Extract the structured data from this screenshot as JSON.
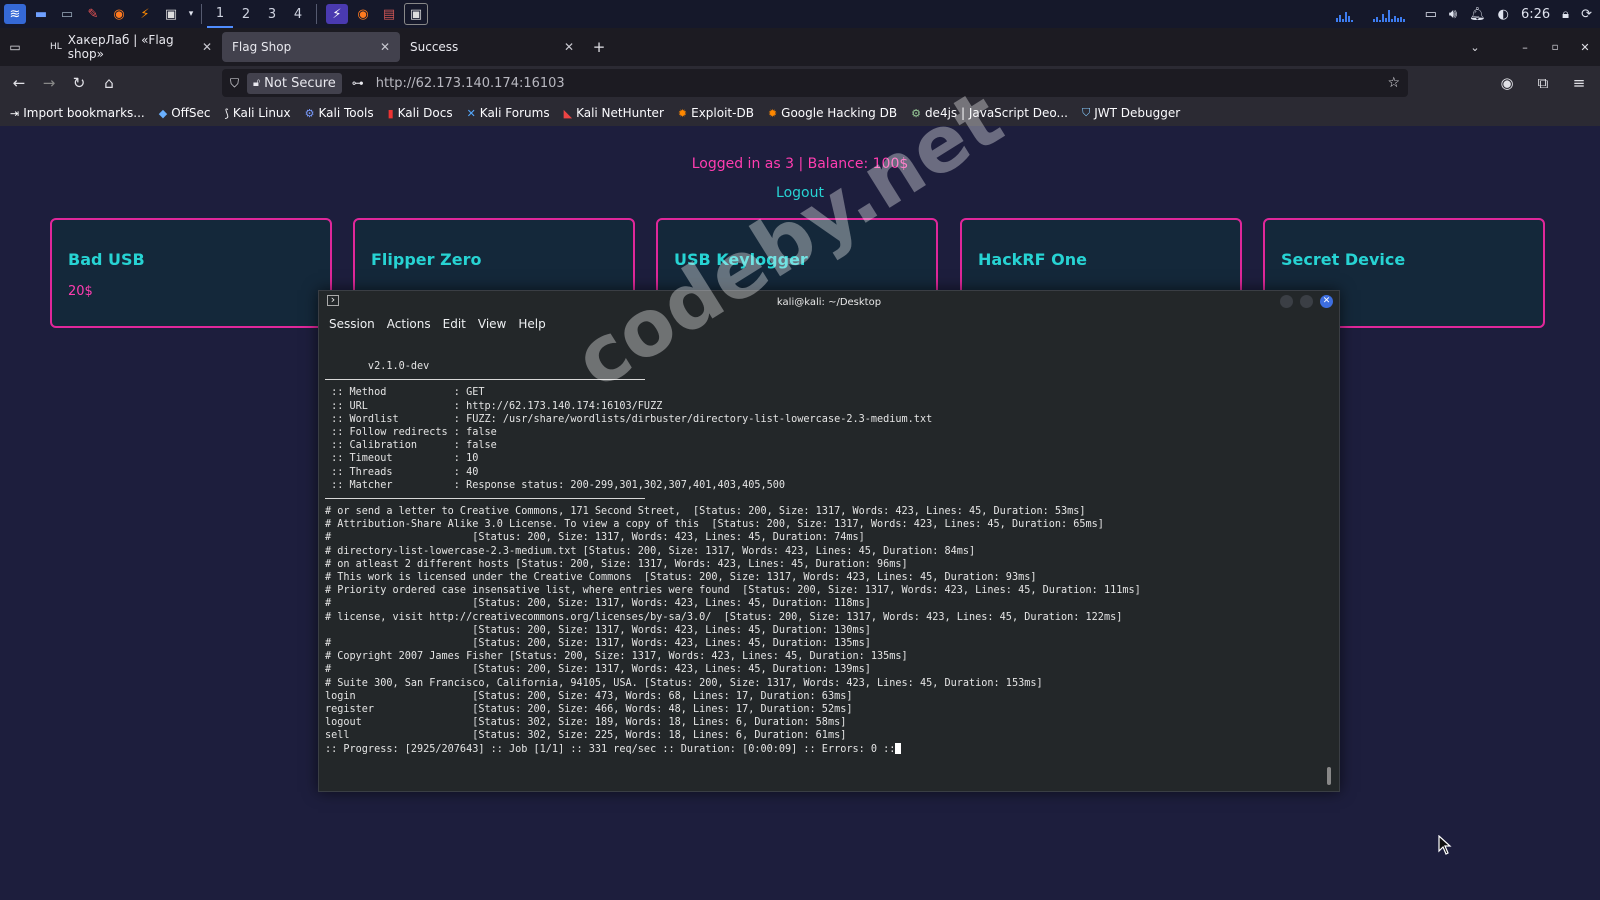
{
  "taskbar": {
    "workspaces": [
      "1",
      "2",
      "3",
      "4"
    ],
    "time": "6:26"
  },
  "tabs": [
    {
      "label": "ХакерЛаб | «Flag shop»"
    },
    {
      "label": "Flag Shop"
    },
    {
      "label": "Success"
    }
  ],
  "urlbar": {
    "security_label": "Not Secure",
    "url": "http://62.173.140.174:16103"
  },
  "bookmarks": [
    {
      "label": "Import bookmarks..."
    },
    {
      "label": "OffSec"
    },
    {
      "label": "Kali Linux"
    },
    {
      "label": "Kali Tools"
    },
    {
      "label": "Kali Docs"
    },
    {
      "label": "Kali Forums"
    },
    {
      "label": "Kali NetHunter"
    },
    {
      "label": "Exploit-DB"
    },
    {
      "label": "Google Hacking DB"
    },
    {
      "label": "de4js | JavaScript Deo..."
    },
    {
      "label": "JWT Debugger"
    }
  ],
  "page": {
    "login_text": "Logged in as 3 | Balance: 100$",
    "logout": "Logout",
    "cards": [
      {
        "title": "Bad USB",
        "price": "20$"
      },
      {
        "title": "Flipper Zero",
        "price": ""
      },
      {
        "title": "USB Keylogger",
        "price": ""
      },
      {
        "title": "HackRF One",
        "price": ""
      },
      {
        "title": "Secret Device",
        "price": ""
      }
    ]
  },
  "terminal": {
    "title": "kali@kali: ~/Desktop",
    "menu": [
      "Session",
      "Actions",
      "Edit",
      "View",
      "Help"
    ],
    "version": "       v2.1.0-dev",
    "config": [
      " :: Method           : GET",
      " :: URL              : http://62.173.140.174:16103/FUZZ",
      " :: Wordlist         : FUZZ: /usr/share/wordlists/dirbuster/directory-list-lowercase-2.3-medium.txt",
      " :: Follow redirects : false",
      " :: Calibration      : false",
      " :: Timeout          : 10",
      " :: Threads          : 40",
      " :: Matcher          : Response status: 200-299,301,302,307,401,403,405,500"
    ],
    "results": [
      "# or send a letter to Creative Commons, 171 Second Street,  [Status: 200, Size: 1317, Words: 423, Lines: 45, Duration: 53ms]",
      "# Attribution-Share Alike 3.0 License. To view a copy of this  [Status: 200, Size: 1317, Words: 423, Lines: 45, Duration: 65ms]",
      "#                       [Status: 200, Size: 1317, Words: 423, Lines: 45, Duration: 74ms]",
      "# directory-list-lowercase-2.3-medium.txt [Status: 200, Size: 1317, Words: 423, Lines: 45, Duration: 84ms]",
      "# on atleast 2 different hosts [Status: 200, Size: 1317, Words: 423, Lines: 45, Duration: 96ms]",
      "# This work is licensed under the Creative Commons  [Status: 200, Size: 1317, Words: 423, Lines: 45, Duration: 93ms]",
      "# Priority ordered case insensative list, where entries were found  [Status: 200, Size: 1317, Words: 423, Lines: 45, Duration: 111ms]",
      "#                       [Status: 200, Size: 1317, Words: 423, Lines: 45, Duration: 118ms]",
      "# license, visit http://creativecommons.org/licenses/by-sa/3.0/  [Status: 200, Size: 1317, Words: 423, Lines: 45, Duration: 122ms]",
      "                        [Status: 200, Size: 1317, Words: 423, Lines: 45, Duration: 130ms]",
      "#                       [Status: 200, Size: 1317, Words: 423, Lines: 45, Duration: 135ms]",
      "# Copyright 2007 James Fisher [Status: 200, Size: 1317, Words: 423, Lines: 45, Duration: 135ms]",
      "#                       [Status: 200, Size: 1317, Words: 423, Lines: 45, Duration: 139ms]",
      "# Suite 300, San Francisco, California, 94105, USA. [Status: 200, Size: 1317, Words: 423, Lines: 45, Duration: 153ms]",
      "login                   [Status: 200, Size: 473, Words: 68, Lines: 17, Duration: 63ms]",
      "register                [Status: 200, Size: 466, Words: 48, Lines: 17, Duration: 52ms]",
      "logout                  [Status: 302, Size: 189, Words: 18, Lines: 6, Duration: 58ms]",
      "sell                    [Status: 302, Size: 225, Words: 18, Lines: 6, Duration: 61ms]"
    ],
    "progress": ":: Progress: [2925/207643] :: Job [1/1] :: 331 req/sec :: Duration: [0:00:09] :: Errors: 0 ::"
  },
  "watermark": "codeby.net"
}
